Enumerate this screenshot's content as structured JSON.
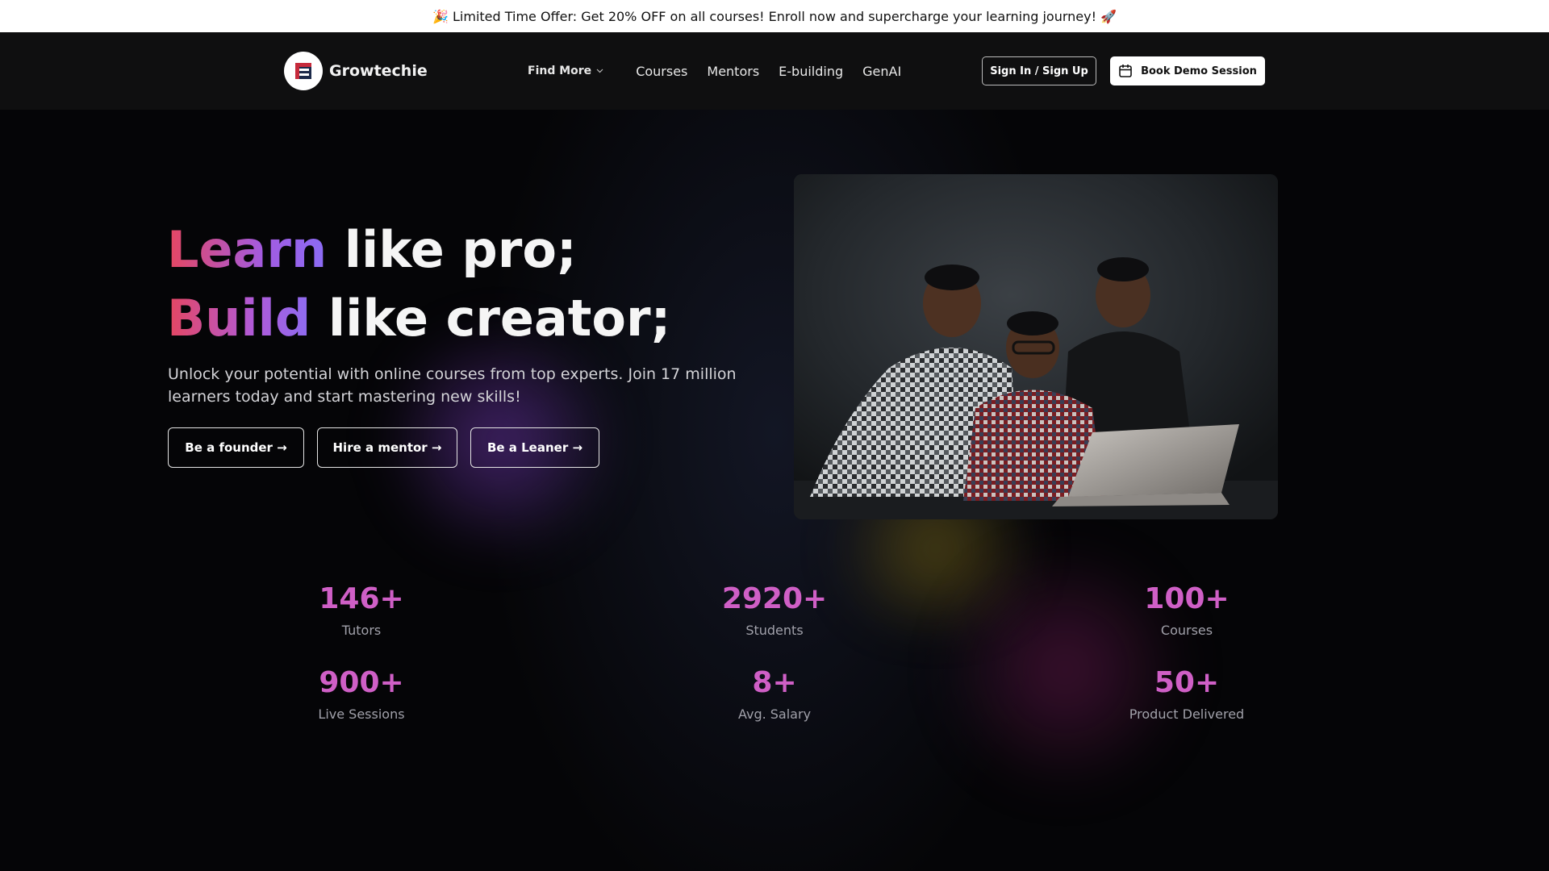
{
  "announcement": {
    "text": "🎉 Limited Time Offer: Get 20% OFF on all courses! Enroll now and supercharge your learning journey! 🚀"
  },
  "navbar": {
    "brand": "Growtechie",
    "find_more": "Find More",
    "links": [
      "Courses",
      "Mentors",
      "E-building",
      "GenAI"
    ],
    "signin_label": "Sign In / Sign Up",
    "demo_label": "Book Demo Session"
  },
  "hero": {
    "line1_highlight": "Learn",
    "line1_rest": " like pro;",
    "line2_highlight": "Build",
    "line2_rest": " like creator;",
    "subtitle": "Unlock your potential with online courses from top experts. Join 17 million learners today and start mastering new skills!",
    "cta": [
      "Be a founder →",
      "Hire a mentor →",
      "Be a Leaner →"
    ]
  },
  "stats": [
    {
      "value": "146+",
      "label": "Tutors"
    },
    {
      "value": "2920+",
      "label": "Students"
    },
    {
      "value": "100+",
      "label": "Courses"
    },
    {
      "value": "900+",
      "label": "Live Sessions"
    },
    {
      "value": "8+",
      "label": "Avg. Salary"
    },
    {
      "value": "50+",
      "label": "Product Delivered"
    }
  ],
  "colors": {
    "accent_pink": "#cf5fc6",
    "gradient_start": "#e64660",
    "gradient_end": "#8b6cf5"
  }
}
